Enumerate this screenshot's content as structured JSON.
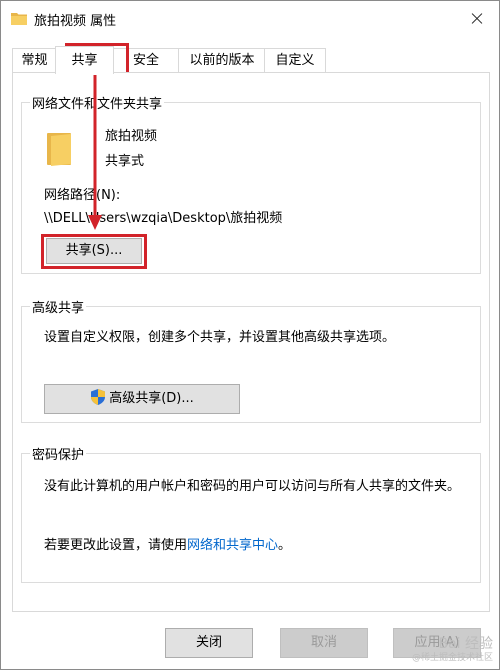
{
  "window": {
    "title": "旅拍视频 属性"
  },
  "tabs": [
    {
      "label": "常规"
    },
    {
      "label": "共享"
    },
    {
      "label": "安全"
    },
    {
      "label": "以前的版本"
    },
    {
      "label": "自定义"
    }
  ],
  "network_sharing": {
    "group_title": "网络文件和文件夹共享",
    "folder_name": "旅拍视频",
    "share_status": "共享式",
    "path_label": "网络路径(N):",
    "path_value": "\\\\DELL\\Users\\wzqia\\Desktop\\旅拍视频",
    "share_button": "共享(S)..."
  },
  "advanced_sharing": {
    "group_title": "高级共享",
    "description": "设置自定义权限，创建多个共享，并设置其他高级共享选项。",
    "button": "高级共享(D)..."
  },
  "password_protection": {
    "group_title": "密码保护",
    "description": "没有此计算机的用户帐户和密码的用户可以访问与所有人共享的文件夹。",
    "change_text": "若要更改此设置，请使用",
    "link_text": "网络和共享中心",
    "period": "。"
  },
  "footer": {
    "close_button": "关闭",
    "cancel_button": "取消",
    "apply_button": "应用(A)"
  },
  "watermark": {
    "brand": "Bai 经验",
    "sub": "@稀土掘金技术社区"
  },
  "colors": {
    "highlight": "#d2232a",
    "link": "#0066cc",
    "folder": "#f7cf63"
  },
  "icons": [
    "folder-icon",
    "close-icon",
    "shield-icon",
    "arrow-annotation"
  ]
}
